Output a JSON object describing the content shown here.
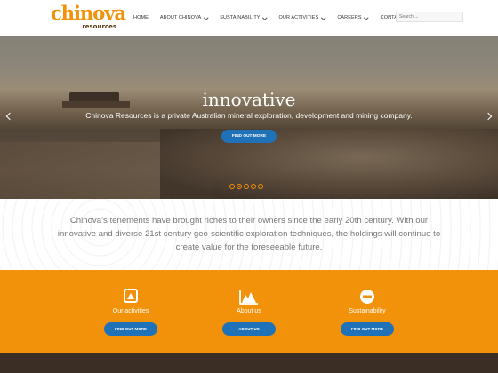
{
  "logo": {
    "main": "chinova",
    "sub": "resources"
  },
  "nav": {
    "items": [
      {
        "label": "HOME",
        "dropdown": false
      },
      {
        "label": "ABOUT CHINOVA",
        "dropdown": true
      },
      {
        "label": "SUSTAINABILITY",
        "dropdown": true
      },
      {
        "label": "OUR ACTIVITIES",
        "dropdown": true
      },
      {
        "label": "CAREERS",
        "dropdown": true
      },
      {
        "label": "CONTACT",
        "dropdown": false
      }
    ]
  },
  "search": {
    "placeholder": "Search ..."
  },
  "hero": {
    "title": "innovative",
    "text": "Chinova Resources is a private Australian mineral exploration, development and mining company.",
    "button": "FIND OUT MORE",
    "slides": 5,
    "active_slide": 2
  },
  "intro": {
    "text": "Chinova’s tenements have brought riches to their owners since the early 20th century. With our innovative and diverse 21st century geo-scientific exploration techniques, the holdings will continue to create value for the foreseeable future."
  },
  "features": [
    {
      "label": "Our activities",
      "button": "FIND OUT MORE",
      "icon": "triangle-box-icon"
    },
    {
      "label": "About us",
      "button": "ABOUT US",
      "icon": "mountain-chart-icon"
    },
    {
      "label": "Sustainability",
      "button": "FIND OUT MORE",
      "icon": "minus-circle-icon"
    }
  ],
  "colors": {
    "accent": "#f2920a",
    "button": "#1f71b8",
    "text_muted": "#777777"
  }
}
